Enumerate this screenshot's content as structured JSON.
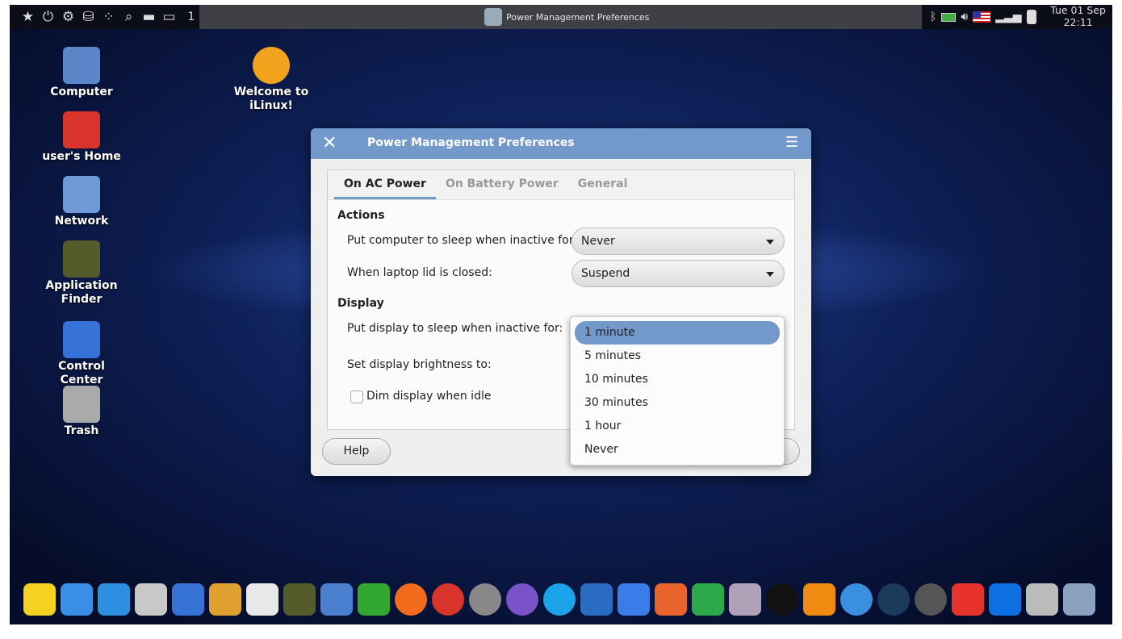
{
  "panel": {
    "workspace": "1",
    "window_title": "Power Management Preferences",
    "clock_day": "Tue 01 Sep",
    "clock_time": "22:11",
    "launchers": [
      "favorites-icon",
      "power-icon",
      "settings-toggle-icon",
      "finder-icon",
      "apps-grid-icon",
      "search-icon",
      "folder-icon",
      "desktop-icon"
    ]
  },
  "desktop": [
    {
      "label": "Computer",
      "color": "#5b86c9"
    },
    {
      "label": "Welcome to iLinux!",
      "color": "#f2a21c"
    },
    {
      "label": "user's Home",
      "color": "#d9342b"
    },
    {
      "label": "Network",
      "color": "#6f9ad6"
    },
    {
      "label": "Application Finder",
      "color": "#545c2c"
    },
    {
      "label": "Control Center",
      "color": "#3672d8"
    },
    {
      "label": "Trash",
      "color": "#aaaaaa"
    }
  ],
  "dialog": {
    "title": "Power Management Preferences",
    "tabs": [
      "On AC Power",
      "On Battery Power",
      "General"
    ],
    "actions_heading": "Actions",
    "sleep_label": "Put computer to sleep when inactive for:",
    "sleep_value": "Never",
    "lid_label": "When laptop lid is closed:",
    "lid_value": "Suspend",
    "display_heading": "Display",
    "display_sleep_label": "Put display to sleep when inactive for:",
    "brightness_label": "Set display brightness to:",
    "dim_label": "Dim display when idle",
    "dim_checked": false,
    "help": "Help"
  },
  "dropdown": {
    "options": [
      "1 minute",
      "5 minutes",
      "10 minutes",
      "30 minutes",
      "1 hour",
      "Never"
    ],
    "selected": "1 minute"
  },
  "accent": "#7399cb",
  "dock": [
    [
      "favorites",
      "#f5d21f"
    ],
    [
      "apps",
      "#3a8ee6"
    ],
    [
      "window",
      "#2e8fe0"
    ],
    [
      "file-cabinet",
      "#c8c8c8"
    ],
    [
      "control-center",
      "#3672d8"
    ],
    [
      "palette",
      "#e0a030"
    ],
    [
      "store",
      "#e8e8e8"
    ],
    [
      "binoculars",
      "#545c2c"
    ],
    [
      "rocket",
      "#4a7fd0"
    ],
    [
      "pipe",
      "#32a832"
    ],
    [
      "firefox",
      "#f36b1c"
    ],
    [
      "chrome",
      "#d9342b"
    ],
    [
      "disk-pro",
      "#888888"
    ],
    [
      "viber",
      "#7a52c8"
    ],
    [
      "skype",
      "#1aa3e8"
    ],
    [
      "thunderbird",
      "#2a6cc4"
    ],
    [
      "writer",
      "#3b7de8"
    ],
    [
      "presentation",
      "#e8642c"
    ],
    [
      "spreadsheet",
      "#2ea84c"
    ],
    [
      "image-viewer",
      "#b0a0b8"
    ],
    [
      "amazon",
      "#111111"
    ],
    [
      "vlc",
      "#f08a10"
    ],
    [
      "qbittorrent",
      "#3b8fe0"
    ],
    [
      "steam",
      "#1b3a5c"
    ],
    [
      "timeshift",
      "#555555"
    ],
    [
      "anydesk",
      "#e8332c"
    ],
    [
      "teamviewer",
      "#0e6fe0"
    ],
    [
      "trash",
      "#bbbbbb"
    ],
    [
      "removable",
      "#8aa2c0"
    ]
  ]
}
